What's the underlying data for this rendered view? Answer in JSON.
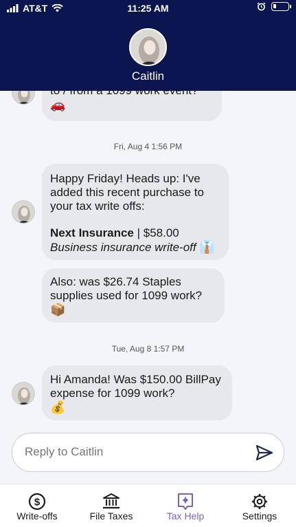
{
  "status_bar": {
    "carrier": "AT&T",
    "time": "11:25 AM"
  },
  "header": {
    "contact_name": "Caitlin"
  },
  "messages": {
    "partial_text": "to / from a 1099 work event?",
    "partial_emoji": "🚗",
    "timestamp_1": "Fri, Aug 4 1:56 PM",
    "msg1_line": "Happy Friday! Heads up: I've added this recent purchase to your tax write offs:",
    "msg1_item_name": "Next Insurance",
    "msg1_item_sep": " | ",
    "msg1_item_amount": "$58.00",
    "msg1_item_desc": "Business insurance write-off",
    "msg1_item_emoji": "👔",
    "msg2_text": "Also: was $26.74 Staples supplies used for 1099 work?",
    "msg2_emoji": "📦",
    "timestamp_2": "Tue, Aug 8 1:57 PM",
    "msg3_text": "Hi Amanda! Was $150.00 BillPay expense for 1099 work?",
    "msg3_emoji": "💰"
  },
  "reply": {
    "placeholder": "Reply to Caitlin"
  },
  "tabs": [
    {
      "label": "Write-offs",
      "icon": "dollar-circle-icon"
    },
    {
      "label": "File Taxes",
      "icon": "bank-icon"
    },
    {
      "label": "Tax Help",
      "icon": "sparkle-chat-icon"
    },
    {
      "label": "Settings",
      "icon": "gear-icon"
    }
  ],
  "colors": {
    "header_bg": "#0b1550",
    "active_tab": "#7b5fc7",
    "bubble_bg": "#e7e8ec"
  }
}
